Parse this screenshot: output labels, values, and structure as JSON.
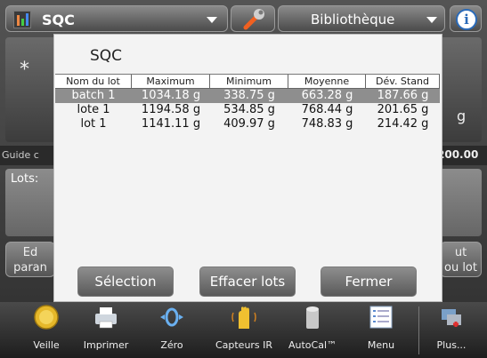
{
  "app": {
    "title": "SQC",
    "library_label": "Bibliothèque",
    "info_glyph": "i"
  },
  "background": {
    "star": "*",
    "unit": "g",
    "guide_text": "Guide c",
    "guide_value": "200.00",
    "lots_label": "Lots:",
    "left_button": "Ed\nparan",
    "right_button": "ut\nou lot"
  },
  "dialog": {
    "title": "SQC",
    "columns": [
      "Nom du lot",
      "Maximum",
      "Minimum",
      "Moyenne",
      "Dév. Stand"
    ],
    "rows": [
      [
        "batch 1",
        "1034.18 g",
        "338.75 g",
        "663.28 g",
        "187.66 g"
      ],
      [
        "lote 1",
        "1194.58 g",
        "534.85 g",
        "768.44 g",
        "201.65 g"
      ],
      [
        "lot 1",
        "1141.11 g",
        "409.97 g",
        "748.83 g",
        "214.42 g"
      ]
    ],
    "selected_row": 0,
    "buttons": {
      "select": "Sélection",
      "clear": "Effacer lots",
      "close": "Fermer"
    }
  },
  "toolbar": {
    "items": [
      {
        "label": "Veille",
        "icon": "standby-icon"
      },
      {
        "label": "Imprimer",
        "icon": "printer-icon"
      },
      {
        "label": "Zéro",
        "icon": "zero-icon"
      },
      {
        "label": "Capteurs IR",
        "icon": "ir-sensor-icon"
      },
      {
        "label": "AutoCal™",
        "icon": "autocal-icon"
      },
      {
        "label": "Menu",
        "icon": "menu-icon"
      },
      {
        "label": "Plus...",
        "icon": "more-icon"
      }
    ]
  },
  "colors": {
    "accent": "#2a6ab8",
    "selected_row": "#8e8e8e",
    "dialog_bg": "#f3f3f3"
  }
}
